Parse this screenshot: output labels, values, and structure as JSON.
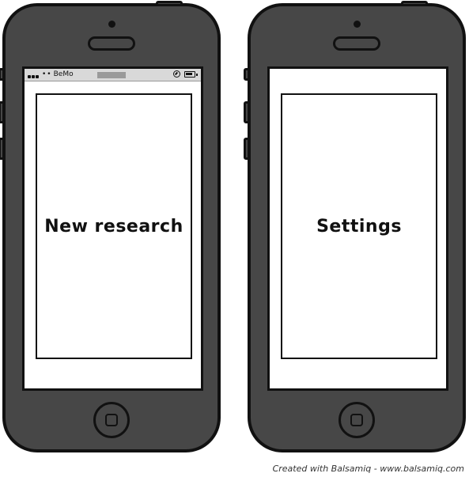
{
  "left_phone": {
    "status_bar": {
      "carrier_dots": "••",
      "carrier": "BeMo"
    },
    "label": "New research"
  },
  "right_phone": {
    "label": "Settings"
  },
  "footer": {
    "credit": "Created with Balsamiq - www.balsamiq.com"
  },
  "colors": {
    "phone_body": "#474747",
    "outline": "#111111",
    "status_bar": "#d9d9d9",
    "screen": "#ffffff"
  },
  "icons": [
    "signal-icon",
    "compass-icon",
    "battery-icon",
    "home-icon"
  ]
}
